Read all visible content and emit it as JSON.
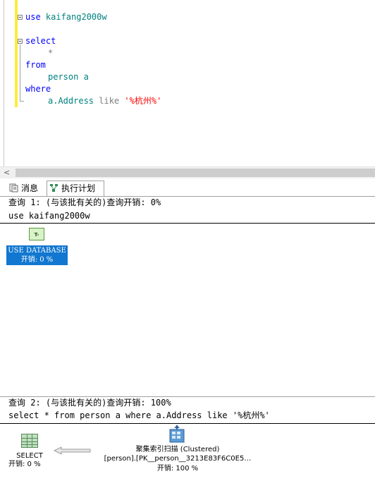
{
  "editor": {
    "lines": [
      {
        "kw": "use",
        "rest": " kaifang2000w"
      },
      {
        "kw": "select"
      },
      {
        "gray": "*"
      },
      {
        "kw": "from"
      },
      {
        "id": "person a"
      },
      {
        "kw": "where"
      },
      {
        "id": "a.Address",
        "gray": " like ",
        "str": "'%杭州%'"
      }
    ]
  },
  "scrollbar": {
    "left_arrow": "<"
  },
  "tabs": [
    {
      "label": "消息",
      "icon": "messages-icon"
    },
    {
      "label": "执行计划",
      "icon": "execution-plan-icon",
      "active": true
    }
  ],
  "query1": {
    "header": "查询 1: (与该批有关的)查询开销: 0%",
    "sql": "use kaifang2000w",
    "node": {
      "icon_label": "T-SQL",
      "title": "USE DATABASE",
      "cost": "开销: 0 %"
    }
  },
  "query2": {
    "header": "查询 2: (与该批有关的)查询开销: 100%",
    "sql": "select * from person a where a.Address like '%杭州%'",
    "select_node": {
      "title": "SELECT",
      "cost": "开销: 0 %"
    },
    "scan_node": {
      "title": "聚集索引扫描 (Clustered)",
      "object": "[person].[PK__person__3213E83F6C0E5…",
      "cost": "开销: 100 %"
    }
  },
  "colors": {
    "change_bar": "#ffeb3b",
    "keyword": "#0000ff",
    "identifier": "#008080",
    "string": "#ff0000",
    "selected_node": "#1177d0"
  }
}
